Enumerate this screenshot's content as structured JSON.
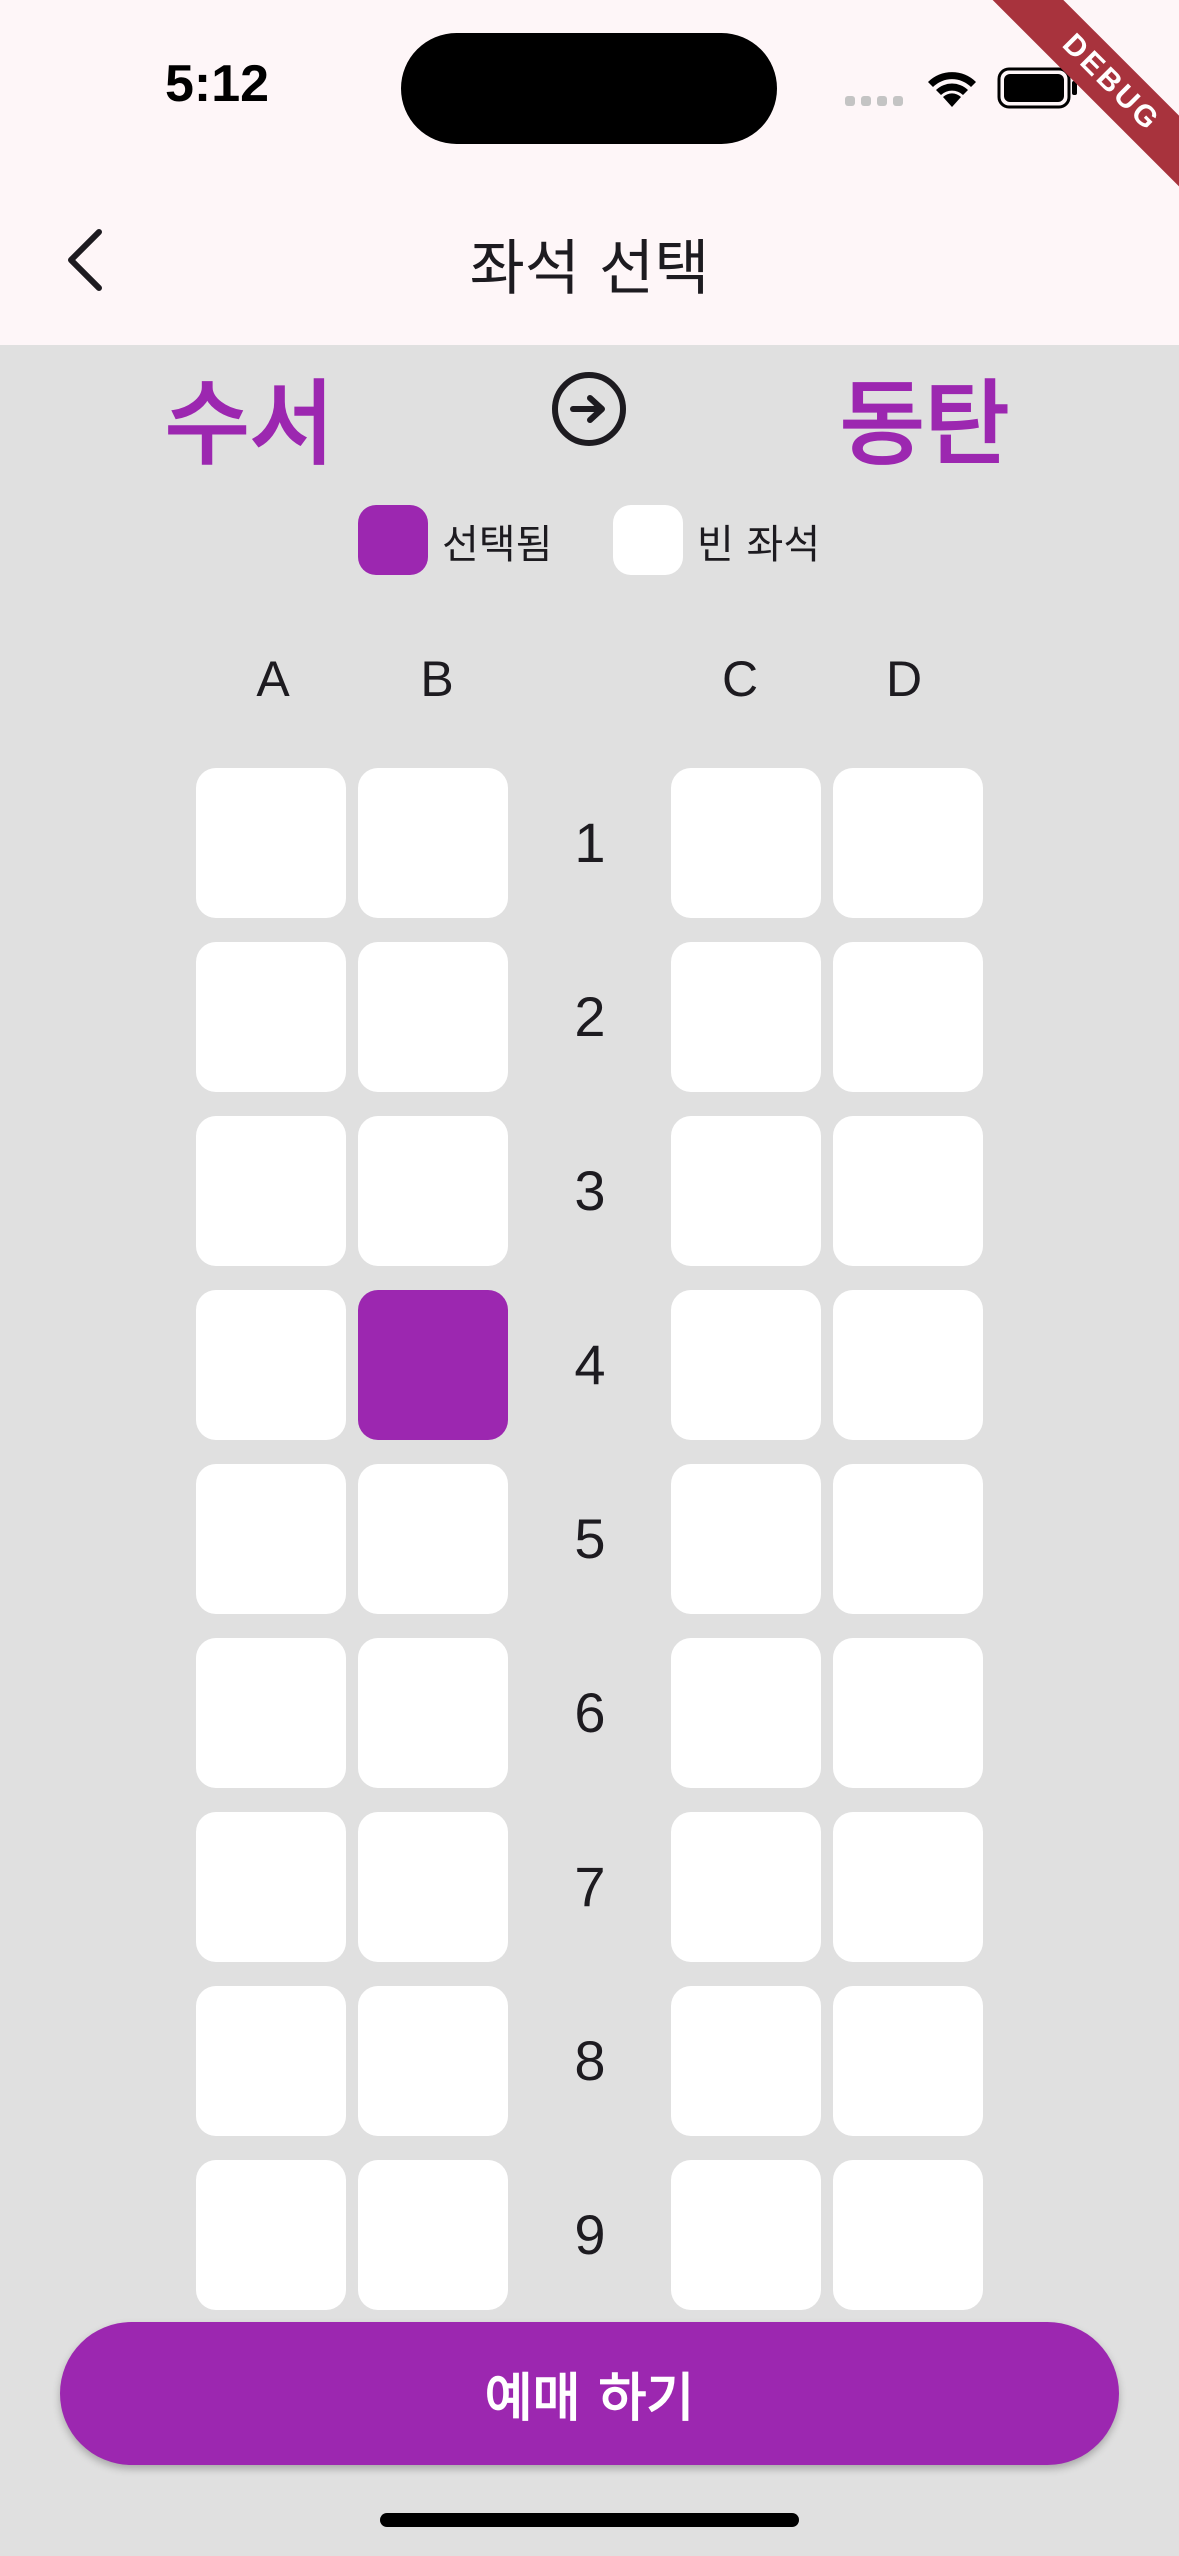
{
  "status_bar": {
    "time": "5:12"
  },
  "debug_banner": "DEBUG",
  "app_bar": {
    "title": "좌석 선택"
  },
  "route": {
    "departure": "수서",
    "arrival": "동탄"
  },
  "legend": {
    "selected_label": "선택됨",
    "empty_label": "빈 좌석"
  },
  "columns": [
    "A",
    "B",
    "C",
    "D"
  ],
  "rows": [
    "1",
    "2",
    "3",
    "4",
    "5",
    "6",
    "7",
    "8",
    "9"
  ],
  "selected_seat": {
    "row": "4",
    "column": "B"
  },
  "book_button_label": "예매 하기",
  "colors": {
    "accent": "#9c27b0",
    "background": "#e0e0e0",
    "app_bar": "#fef6f8",
    "seat_empty": "#ffffff"
  }
}
